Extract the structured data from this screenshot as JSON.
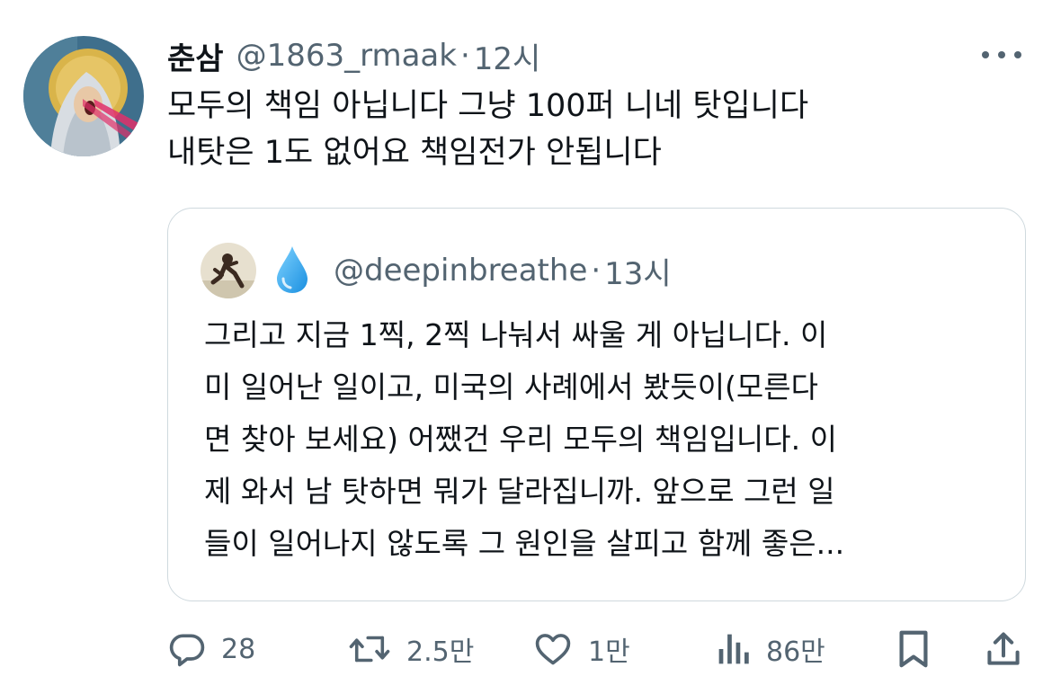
{
  "tweet": {
    "author_name": "춘삼",
    "author_handle": "@1863_rmaak",
    "separator": "·",
    "time": "12시",
    "text_lines": [
      "모두의 책임 아닙니다 그냥 100퍼 니네 탓입니다",
      "내탓은 1도 없어요 책임전가 안됩니다"
    ],
    "avatar_icon": "avatar-image",
    "more_icon": "more-dots-icon"
  },
  "quote": {
    "emoji_icon": "droplet-icon",
    "handle": "@deepinbreathe",
    "separator": "·",
    "time": "13시",
    "text_lines": [
      "그리고 지금 1찍, 2찍 나눠서 싸울 게 아닙니다. 이",
      "미 일어난 일이고, 미국의 사례에서 봤듯이(모른다",
      "면 찾아 보세요) 어쨌건 우리 모두의 책임입니다. 이",
      "제 와서 남 탓하면 뭐가 달라집니까. 앞으로 그런 일",
      "들이 일어나지 않도록 그 원인을 살피고 함께 좋은..."
    ]
  },
  "actions": {
    "reply": {
      "icon": "reply-icon",
      "count": "28"
    },
    "retweet": {
      "icon": "retweet-icon",
      "count": "2.5만"
    },
    "like": {
      "icon": "heart-icon",
      "count": "1만"
    },
    "views": {
      "icon": "views-icon",
      "count": "86만"
    },
    "bookmark": {
      "icon": "bookmark-icon"
    },
    "share": {
      "icon": "share-icon"
    }
  },
  "colors": {
    "text": "#0f1419",
    "secondary": "#536471",
    "border": "#cfd9de",
    "droplet": "#1da1f2"
  }
}
